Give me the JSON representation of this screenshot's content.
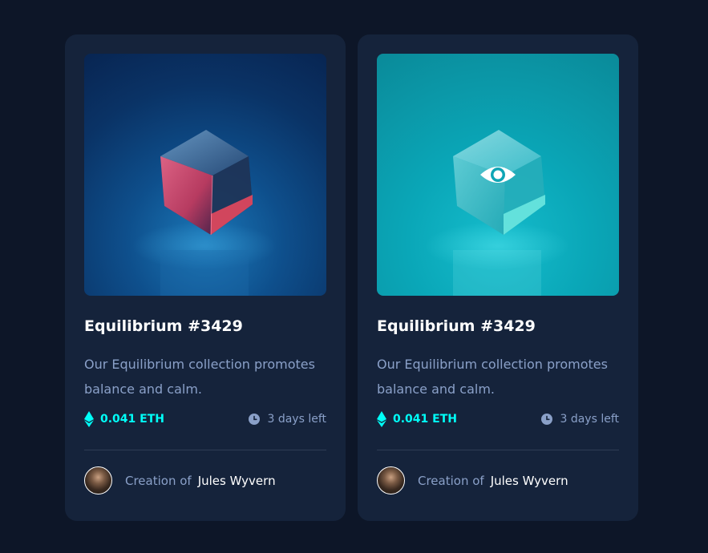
{
  "cards": [
    {
      "title": "Equilibrium #3429",
      "description": "Our Equilibrium collection promotes balance and calm.",
      "price": "0.041 ETH",
      "time_left": "3 days left",
      "creator_prefix": "Creation of",
      "creator_name": "Jules Wyvern",
      "hover_state": false
    },
    {
      "title": "Equilibrium #3429",
      "description": "Our Equilibrium collection promotes balance and calm.",
      "price": "0.041 ETH",
      "time_left": "3 days left",
      "creator_prefix": "Creation of",
      "creator_name": "Jules Wyvern",
      "hover_state": true
    }
  ],
  "icons": {
    "price": "ethereum-icon",
    "time": "clock-icon",
    "overlay": "eye-icon"
  },
  "colors": {
    "page_bg": "#0d1628",
    "card_bg": "#15233b",
    "accent_cyan": "#00fff8",
    "soft_blue": "#8aa0c8",
    "white": "#ffffff"
  }
}
